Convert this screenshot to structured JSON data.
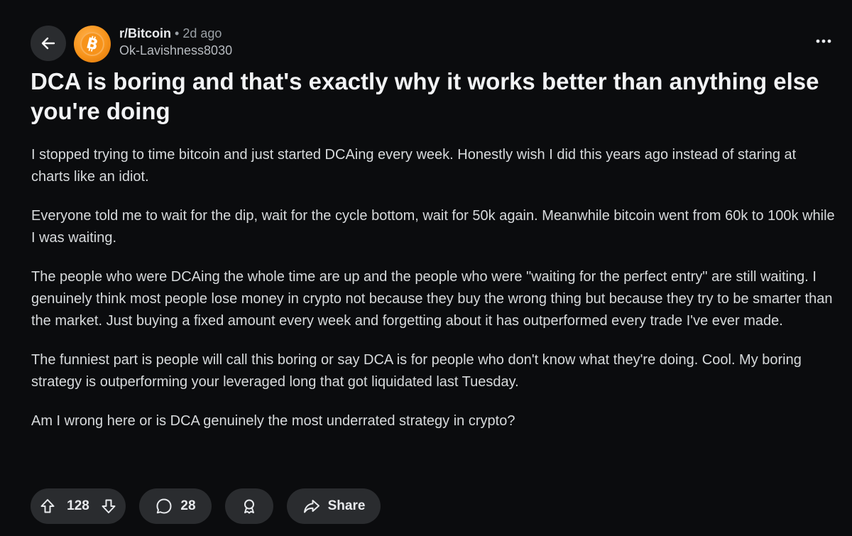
{
  "post": {
    "subreddit": "r/Bitcoin",
    "separator": "•",
    "age": "2d ago",
    "author": "Ok-Lavishness8030",
    "title": "DCA is boring and that's exactly why it works better than anything else you're doing",
    "paragraphs": [
      "I stopped trying to time bitcoin and just started DCAing every week. Honestly wish I did this years ago instead of staring at charts like an idiot.",
      "Everyone told me to wait for the dip, wait for the cycle bottom, wait for 50k again. Meanwhile bitcoin went from 60k to 100k while I was waiting.",
      "The people who were DCAing the whole time are up and the people who were \"waiting for the perfect entry\" are still waiting. I genuinely think most people lose money in crypto not because they buy the wrong thing but because they try to be smarter than the market. Just buying a fixed amount every week and forgetting about it has outperformed every trade I've ever made.",
      "The funniest part is people will call this boring or say DCA is for people who don't know what they're doing. Cool. My boring strategy is outperforming your leveraged long that got liquidated last Tuesday.",
      "Am I wrong here or is DCA genuinely the most underrated strategy in crypto?"
    ]
  },
  "actions": {
    "votes": "128",
    "comments": "28",
    "share_label": "Share"
  },
  "icons": {
    "back": "arrow-left-icon",
    "avatar": "bitcoin-logo-icon",
    "more": "more-horizontal-icon",
    "upvote": "arrow-up-icon",
    "downvote": "arrow-down-icon",
    "comment": "comment-bubble-icon",
    "award": "award-ribbon-icon",
    "share": "share-arrow-icon"
  },
  "colors": {
    "background": "#0b0c0e",
    "pill": "#2a2c2f",
    "text": "#d7dadc",
    "bitcoin_orange": "#f7931a"
  }
}
